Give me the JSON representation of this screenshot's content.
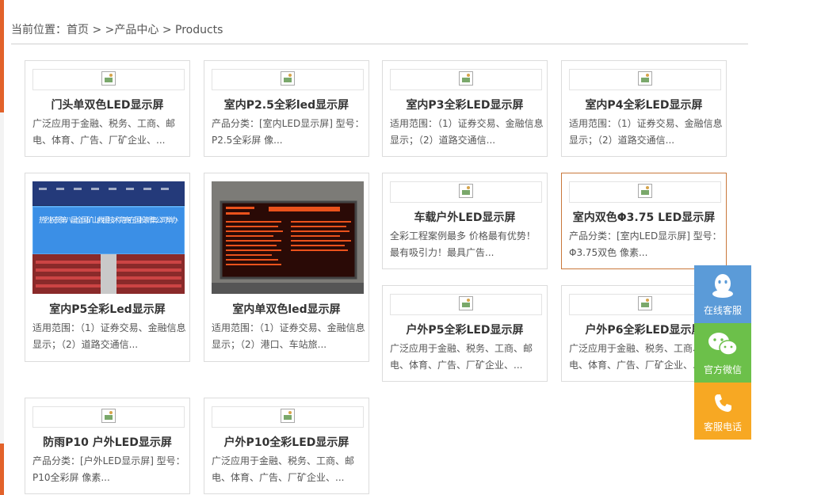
{
  "breadcrumb": {
    "prefix": "当前位置：",
    "home": "首页",
    "sep1": " > ",
    "products_link": ">产品中心",
    "sep2": " > ",
    "current": "Products"
  },
  "products": [
    {
      "title": "门头单双色LED显示屏",
      "desc": "广泛应用于金融、税务、工商、邮电、体育、广告、厂矿企业、..."
    },
    {
      "title": "室内P2.5全彩led显示屏",
      "desc": "产品分类：[室内LED显示屏] 型号：P2.5全彩屏 像..."
    },
    {
      "title": "室内P3全彩LED显示屏",
      "desc": "适用范围：（1）证券交易、金融信息显示；（2）道路交通信..."
    },
    {
      "title": "室内P4全彩LED显示屏",
      "desc": "适用范围：（1）证券交易、金融信息显示；（2）道路交通信..."
    },
    {
      "title": "室内P5全彩Led显示屏",
      "desc": "适用范围：（1）证券交易、金融信息显示；（2）道路交通信...",
      "photo_text": "热烈祝贺第八届全国矿山救援技术竞赛在国投新集公司举办"
    },
    {
      "title": "室内单双色led显示屏",
      "desc": "适用范围：（1）证券交易、金融信息显示；（2）港口、车站旅..."
    },
    {
      "title": "车载户外LED显示屏",
      "desc": "全彩工程案例最多 价格最有优势！最有吸引力！最具广告..."
    },
    {
      "title": "室内双色Φ3.75 LED显示屏",
      "desc": "产品分类：[室内LED显示屏] 型号：Φ3.75双色 像素..."
    },
    {
      "title": "户外P5全彩LED显示屏",
      "desc": "广泛应用于金融、税务、工商、邮电、体育、广告、厂矿企业、..."
    },
    {
      "title": "户外P6全彩LED显示屏",
      "desc": "广泛应用于金融、税务、工商、邮电、体育、广告、厂矿企业、..."
    },
    {
      "title": "防雨P10 户外LED显示屏",
      "desc": "产品分类：[户外LED显示屏] 型号：P10全彩屏 像素..."
    },
    {
      "title": "户外P10全彩LED显示屏",
      "desc": "广泛应用于金融、税务、工商、邮电、体育、广告、厂矿企业、..."
    }
  ],
  "sidebar": {
    "qq": {
      "label": "在线客服",
      "color": "#5b9bd8",
      "icon": "qq-penguin-icon"
    },
    "wechat": {
      "label": "官方微信",
      "color": "#6cc04a",
      "icon": "wechat-icon"
    },
    "phone": {
      "label": "客服电话",
      "color": "#f7a823",
      "icon": "phone-icon"
    }
  },
  "colors": {
    "accent": "#e2622a",
    "active_border": "#c9783b"
  }
}
